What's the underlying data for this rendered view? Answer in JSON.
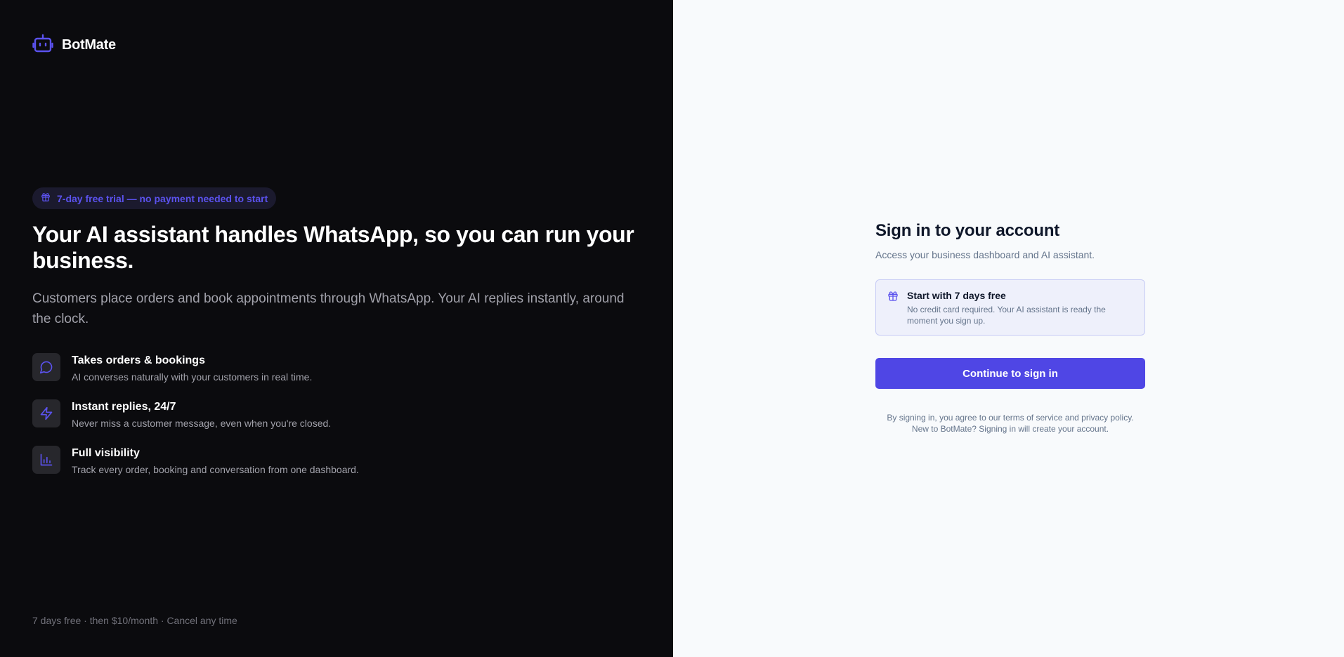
{
  "brand": {
    "name": "BotMate",
    "accent": "#4f46e5"
  },
  "hero": {
    "badge": "7-day free trial — no payment needed to start",
    "title": "Your AI assistant handles WhatsApp, so you can run your business.",
    "subtitle": "Customers place orders and book appointments through WhatsApp. Your AI replies instantly, around the clock.",
    "features": [
      {
        "icon": "chat-bubble-icon",
        "title": "Takes orders & bookings",
        "desc": "AI converses naturally with your customers in real time."
      },
      {
        "icon": "lightning-icon",
        "title": "Instant replies, 24/7",
        "desc": "Never miss a customer message, even when you're closed."
      },
      {
        "icon": "bar-chart-icon",
        "title": "Full visibility",
        "desc": "Track every order, booking and conversation from one dashboard."
      }
    ],
    "footer": "7 days free · then $10/month · Cancel any time"
  },
  "signin": {
    "title": "Sign in to your account",
    "subtitle": "Access your business dashboard and AI assistant.",
    "trial_card": {
      "icon": "gift-icon",
      "title": "Start with 7 days free",
      "desc": "No credit card required. Your AI assistant is ready the moment you sign up."
    },
    "cta_label": "Continue to sign in",
    "legal_line1": "By signing in, you agree to our terms of service and privacy policy.",
    "legal_line2": "New to BotMate? Signing in will create your account."
  }
}
